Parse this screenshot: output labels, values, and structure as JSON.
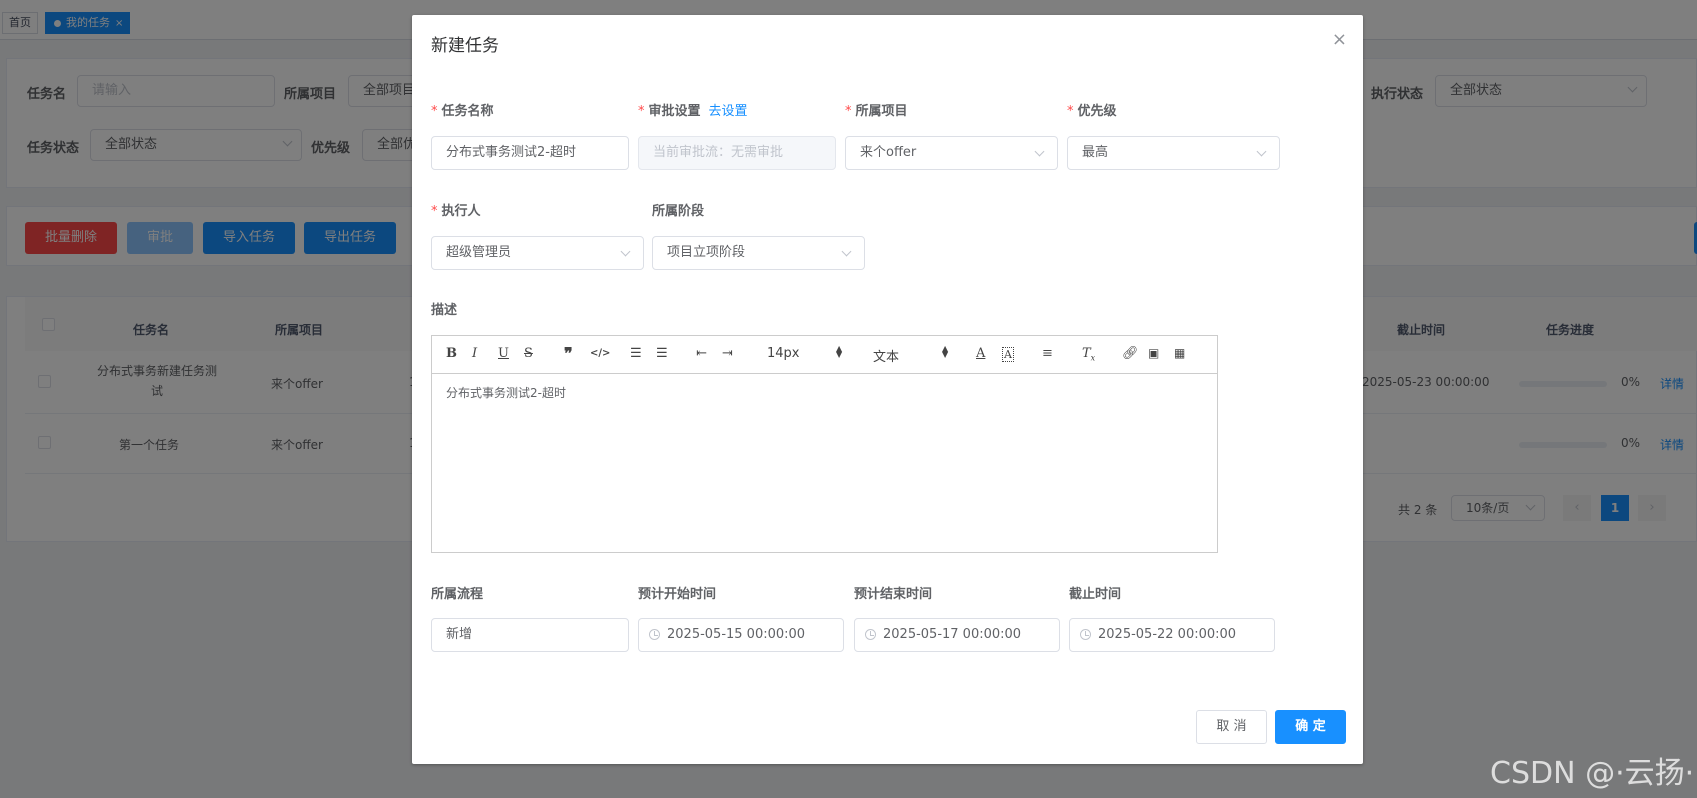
{
  "tabs": [
    {
      "label": "首页",
      "active": false
    },
    {
      "label": "我的任务",
      "active": true,
      "close": "×"
    }
  ],
  "search": {
    "task_name_label": "任务名",
    "task_name_placeholder": "请输入",
    "project_label": "所属项目",
    "project_value": "全部项目",
    "exec_status_label": "执行状态",
    "exec_status_value": "全部状态",
    "task_status_label": "任务状态",
    "task_status_value": "全部状态",
    "priority_label": "优先级",
    "priority_value": "全部优"
  },
  "actions": {
    "batch_delete": "批量删除",
    "approve": "审批",
    "import": "导入任务",
    "export": "导出任务"
  },
  "table": {
    "headers": [
      "任务名",
      "所属项目",
      "截止时间",
      "任务进度"
    ],
    "rows": [
      {
        "name": "分布式事务新建任务测试",
        "project": "来个offer",
        "deadline": "2025-05-23 00:00:00",
        "progress": "0%",
        "progress_value": 0,
        "action": "详情",
        "col3": "1"
      },
      {
        "name": "第一个任务",
        "project": "来个offer",
        "deadline": "",
        "progress": "0%",
        "progress_value": 0,
        "action": "详情",
        "col3": "1"
      }
    ]
  },
  "pagination": {
    "total": "共 2 条",
    "page_size": "10条/页",
    "current": "1",
    "prev": "‹",
    "next": "›"
  },
  "dialog": {
    "title": "新建任务",
    "close": "×",
    "fields": {
      "task_name": {
        "label": "任务名称",
        "value": "分布式事务测试2-超时"
      },
      "approval": {
        "label": "审批设置",
        "link": "去设置",
        "value": "当前审批流：无需审批"
      },
      "project": {
        "label": "所属项目",
        "value": "来个offer"
      },
      "priority": {
        "label": "优先级",
        "value": "最高"
      },
      "executor": {
        "label": "执行人",
        "value": "超级管理员"
      },
      "stage": {
        "label": "所属阶段",
        "value": "项目立项阶段"
      },
      "description": {
        "label": "描述",
        "content": "分布式事务测试2-超时"
      },
      "flow": {
        "label": "所属流程",
        "value": "新增"
      },
      "start_time": {
        "label": "预计开始时间",
        "value": "2025-05-15 00:00:00"
      },
      "end_time": {
        "label": "预计结束时间",
        "value": "2025-05-17 00:00:00"
      },
      "deadline": {
        "label": "截止时间",
        "value": "2025-05-22 00:00:00"
      }
    },
    "toolbar": {
      "font_size": "14px",
      "font_type": "文本"
    },
    "cancel": "取 消",
    "confirm": "确 定"
  },
  "watermark": "CSDN @·云扬·",
  "colors": {
    "primary": "#1890ff",
    "danger": "#ff4949",
    "required": "#ff4949"
  }
}
